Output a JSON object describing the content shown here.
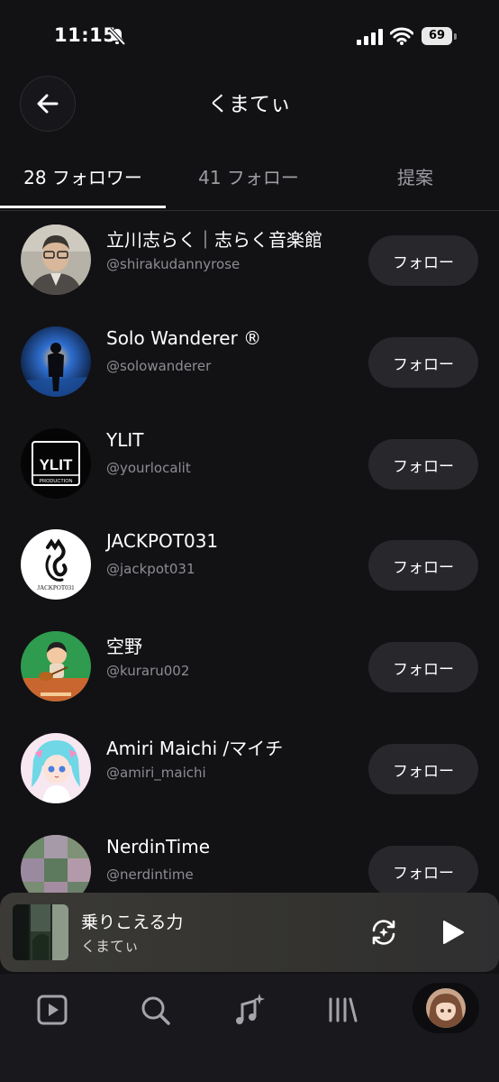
{
  "status_bar": {
    "time": "11:15",
    "battery": "69"
  },
  "header": {
    "title": "くまてぃ"
  },
  "tabs": [
    {
      "label": "28 フォロワー",
      "active": true
    },
    {
      "label": "41 フォロー",
      "active": false
    },
    {
      "label": "提案",
      "active": false
    }
  ],
  "users": [
    {
      "name": "立川志らく｜志らく音楽館",
      "handle": "@shirakudannyrose",
      "button": "フォロー"
    },
    {
      "name": "Solo Wanderer ®",
      "handle": "@solowanderer",
      "button": "フォロー"
    },
    {
      "name": "YLIT",
      "handle": "@yourlocalit",
      "button": "フォロー",
      "avatar_text": "YLIT",
      "avatar_sub": "PRODUCTION"
    },
    {
      "name": "JACKPOT031",
      "handle": "@jackpot031",
      "button": "フォロー",
      "avatar_text": "JACKPOT031"
    },
    {
      "name": "空野",
      "handle": "@kuraru002",
      "button": "フォロー"
    },
    {
      "name": "Amiri Maichi /マイチ",
      "handle": "@amiri_maichi",
      "button": "フォロー"
    },
    {
      "name": "NerdinTime",
      "handle": "@nerdintime",
      "button": "フォロー"
    }
  ],
  "player": {
    "song": "乗りこえる力",
    "artist": "くまてぃ"
  },
  "colors": {
    "background": "#121114",
    "button": "#28272b",
    "muted": "#8e8d93"
  }
}
